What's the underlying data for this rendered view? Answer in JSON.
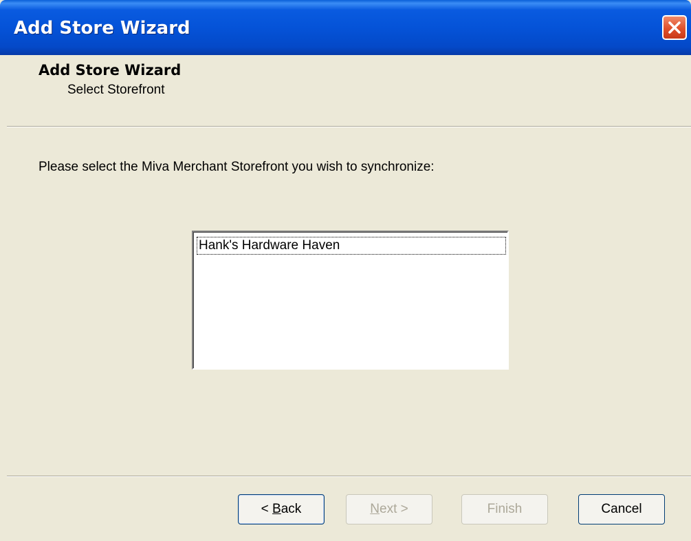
{
  "window": {
    "title": "Add Store Wizard",
    "close_icon": "close-icon"
  },
  "header": {
    "title": "Add Store Wizard",
    "subtitle": "Select Storefront"
  },
  "body": {
    "instruction": "Please select the Miva Merchant Storefront you wish to synchronize:",
    "storefronts": [
      "Hank's Hardware Haven"
    ],
    "selected_index": 0
  },
  "buttons": {
    "back": {
      "prefix": "< ",
      "mnemonic": "B",
      "rest": "ack",
      "enabled": true
    },
    "next": {
      "mnemonic": "N",
      "rest": "ext >",
      "enabled": false
    },
    "finish": {
      "label": "Finish",
      "enabled": false
    },
    "cancel": {
      "label": "Cancel",
      "enabled": true
    }
  },
  "colors": {
    "titlebar": "#0553d8",
    "face": "#ece9d8",
    "close": "#e0502a"
  }
}
